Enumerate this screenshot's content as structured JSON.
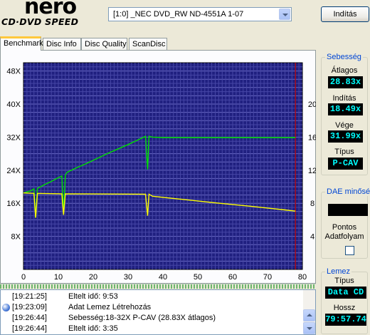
{
  "logo": {
    "brand": "nero",
    "product": "CD·DVD SPEED"
  },
  "drive_select": {
    "value": "[1:0]  _NEC DVD_RW ND-4551A 1-07"
  },
  "start_button": {
    "label": "Indítás"
  },
  "tabs": [
    {
      "label": "Benchmark",
      "active": true
    },
    {
      "label": "Disc Info",
      "active": false
    },
    {
      "label": "Disc Quality",
      "active": false
    },
    {
      "label": "ScanDisc",
      "active": false
    }
  ],
  "chart_data": {
    "type": "line",
    "background": "#202080",
    "grid": true,
    "xlim": [
      0,
      80
    ],
    "x_ticks": [
      "0",
      "10",
      "20",
      "30",
      "40",
      "50",
      "60",
      "70",
      "80"
    ],
    "y_left_ticks": [
      "8X",
      "16X",
      "24X",
      "32X",
      "40X",
      "48X"
    ],
    "y_left_lim": [
      0,
      50
    ],
    "y_right_ticks": [
      "4",
      "8",
      "12",
      "16",
      "20"
    ],
    "y_right_lim": [
      0,
      25
    ],
    "marker_x": 78,
    "series": [
      {
        "color": "#00e000",
        "axis": "left",
        "points": [
          [
            0,
            18.5
          ],
          [
            2,
            19.0
          ],
          [
            3,
            19.5
          ],
          [
            3.5,
            12.5
          ],
          [
            4,
            19.6
          ],
          [
            6,
            20.5
          ],
          [
            8,
            21.3
          ],
          [
            10,
            22.2
          ],
          [
            11,
            22.6
          ],
          [
            11.5,
            13.2
          ],
          [
            12,
            22.8
          ],
          [
            12.5,
            23.5
          ],
          [
            15,
            24.5
          ],
          [
            18,
            25.6
          ],
          [
            21,
            26.8
          ],
          [
            24,
            28.0
          ],
          [
            27,
            29.1
          ],
          [
            30,
            30.2
          ],
          [
            33,
            31.4
          ],
          [
            35,
            32.2
          ],
          [
            35.6,
            24.2
          ],
          [
            36,
            32.2
          ],
          [
            37,
            32.0
          ],
          [
            40,
            31.9
          ],
          [
            50,
            31.9
          ],
          [
            60,
            31.9
          ],
          [
            70,
            31.9
          ],
          [
            78,
            31.9
          ]
        ]
      },
      {
        "color": "#ffff00",
        "axis": "left",
        "points": [
          [
            0,
            18.5
          ],
          [
            3,
            18.4
          ],
          [
            3.5,
            12.5
          ],
          [
            4,
            18.4
          ],
          [
            11,
            18.3
          ],
          [
            11.5,
            13.2
          ],
          [
            12,
            18.3
          ],
          [
            35,
            18.2
          ],
          [
            35.6,
            13.0
          ],
          [
            36,
            18.2
          ],
          [
            37,
            17.7
          ],
          [
            45,
            17.0
          ],
          [
            55,
            16.1
          ],
          [
            65,
            15.3
          ],
          [
            75,
            14.4
          ],
          [
            78,
            14.1
          ]
        ]
      }
    ]
  },
  "speed_group": {
    "title": "Sebesség",
    "average_label": "Átlagos",
    "average_value": "28.83x",
    "start_label": "Indítás",
    "start_value": "18.49x",
    "end_label": "Vége",
    "end_value": "31.99x",
    "type_label": "Típus",
    "type_value": "P-CAV"
  },
  "dae_group": {
    "title": "DAE minőség",
    "accuracy_label_1": "Pontos",
    "accuracy_label_2": "Adatfolyam"
  },
  "disc_group": {
    "title": "Lemez",
    "type_label": "Típus",
    "type_value": "Data CD",
    "length_label": "Hossz",
    "length_value": "79:57.74"
  },
  "log": [
    {
      "time": "[19:21:25]",
      "message": "Eltelt idő:  9:53"
    },
    {
      "time": "[19:23:09]",
      "message": "Adat Lemez Létrehozás"
    },
    {
      "time": "[19:26:44]",
      "message": "Sebesség:18-32X P-CAV (28.83X átlagos)"
    },
    {
      "time": "[19:26:44]",
      "message": "Eltelt idő:  3:35"
    }
  ]
}
